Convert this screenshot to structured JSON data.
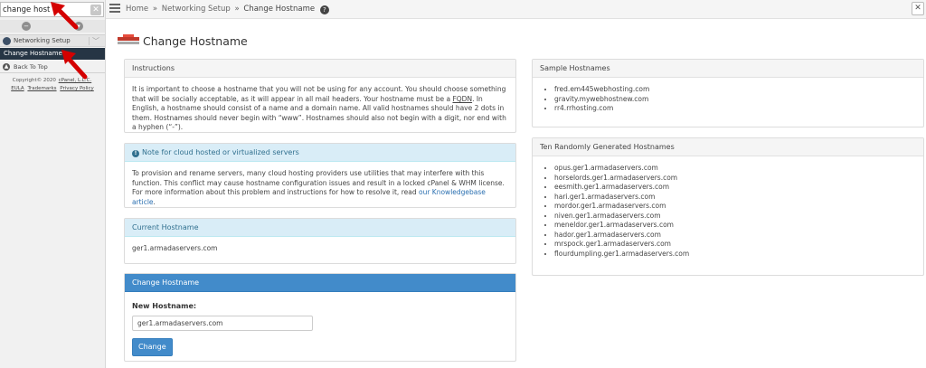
{
  "sidebar": {
    "search_value": "change host",
    "clear_icon": "close-icon",
    "nav": [
      {
        "label": "Networking Setup",
        "icon": "network-icon"
      },
      {
        "label": "Change Hostname"
      }
    ],
    "back_to_top": "Back To Top",
    "copyright": "Copyright© 2020",
    "copyright_link": "cPanel, L.L.C.",
    "links": [
      "EULA",
      "Trademarks",
      "Privacy Policy"
    ]
  },
  "topbar": {
    "breadcrumb": [
      "Home",
      "Networking Setup",
      "Change Hostname"
    ],
    "separator": "»"
  },
  "page": {
    "title": "Change Hostname"
  },
  "instructions": {
    "title": "Instructions",
    "text_1": "It is important to choose a hostname that you will not be using for any account. You should choose something that will be socially acceptable, as it will appear in all mail headers. Your hostname must be a ",
    "fqdn": "FQDN",
    "text_2": ". In English, a hostname should consist of a name and a domain name. All valid hostnames should have 2 dots in them. Hostnames should never begin with “www”. Hostnames should also not begin with a digit, nor end with a hyphen (“-”)."
  },
  "cloud_note": {
    "title": "Note for cloud hosted or virtualized servers",
    "text": "To provision and rename servers, many cloud hosting providers use utilities that may interfere with this function. This conflict may cause hostname configuration issues and result in a locked cPanel & WHM license. For more information about this problem and instructions for how to resolve it, read ",
    "link": "our Knowledgebase article",
    "end": "."
  },
  "current_hostname": {
    "title": "Current Hostname",
    "value": "ger1.armadaservers.com"
  },
  "change_form": {
    "title": "Change Hostname",
    "label": "New Hostname:",
    "input_value": "ger1.armadaservers.com",
    "button": "Change"
  },
  "sample_hostnames": {
    "title": "Sample Hostnames",
    "items": [
      "fred.em445webhosting.com",
      "gravity.mywebhostnew.com",
      "rr4.rrhosting.com"
    ]
  },
  "random_hostnames": {
    "title": "Ten Randomly Generated Hostnames",
    "items": [
      "opus.ger1.armadaservers.com",
      "horselords.ger1.armadaservers.com",
      "eesmith.ger1.armadaservers.com",
      "hari.ger1.armadaservers.com",
      "mordor.ger1.armadaservers.com",
      "niven.ger1.armadaservers.com",
      "meneldor.ger1.armadaservers.com",
      "hador.ger1.armadaservers.com",
      "mrspock.ger1.armadaservers.com",
      "flourdumpling.ger1.armadaservers.com"
    ]
  },
  "colors": {
    "accent": "#428bca",
    "sidebar_active": "#263544",
    "annotation_arrow": "#d40000"
  }
}
